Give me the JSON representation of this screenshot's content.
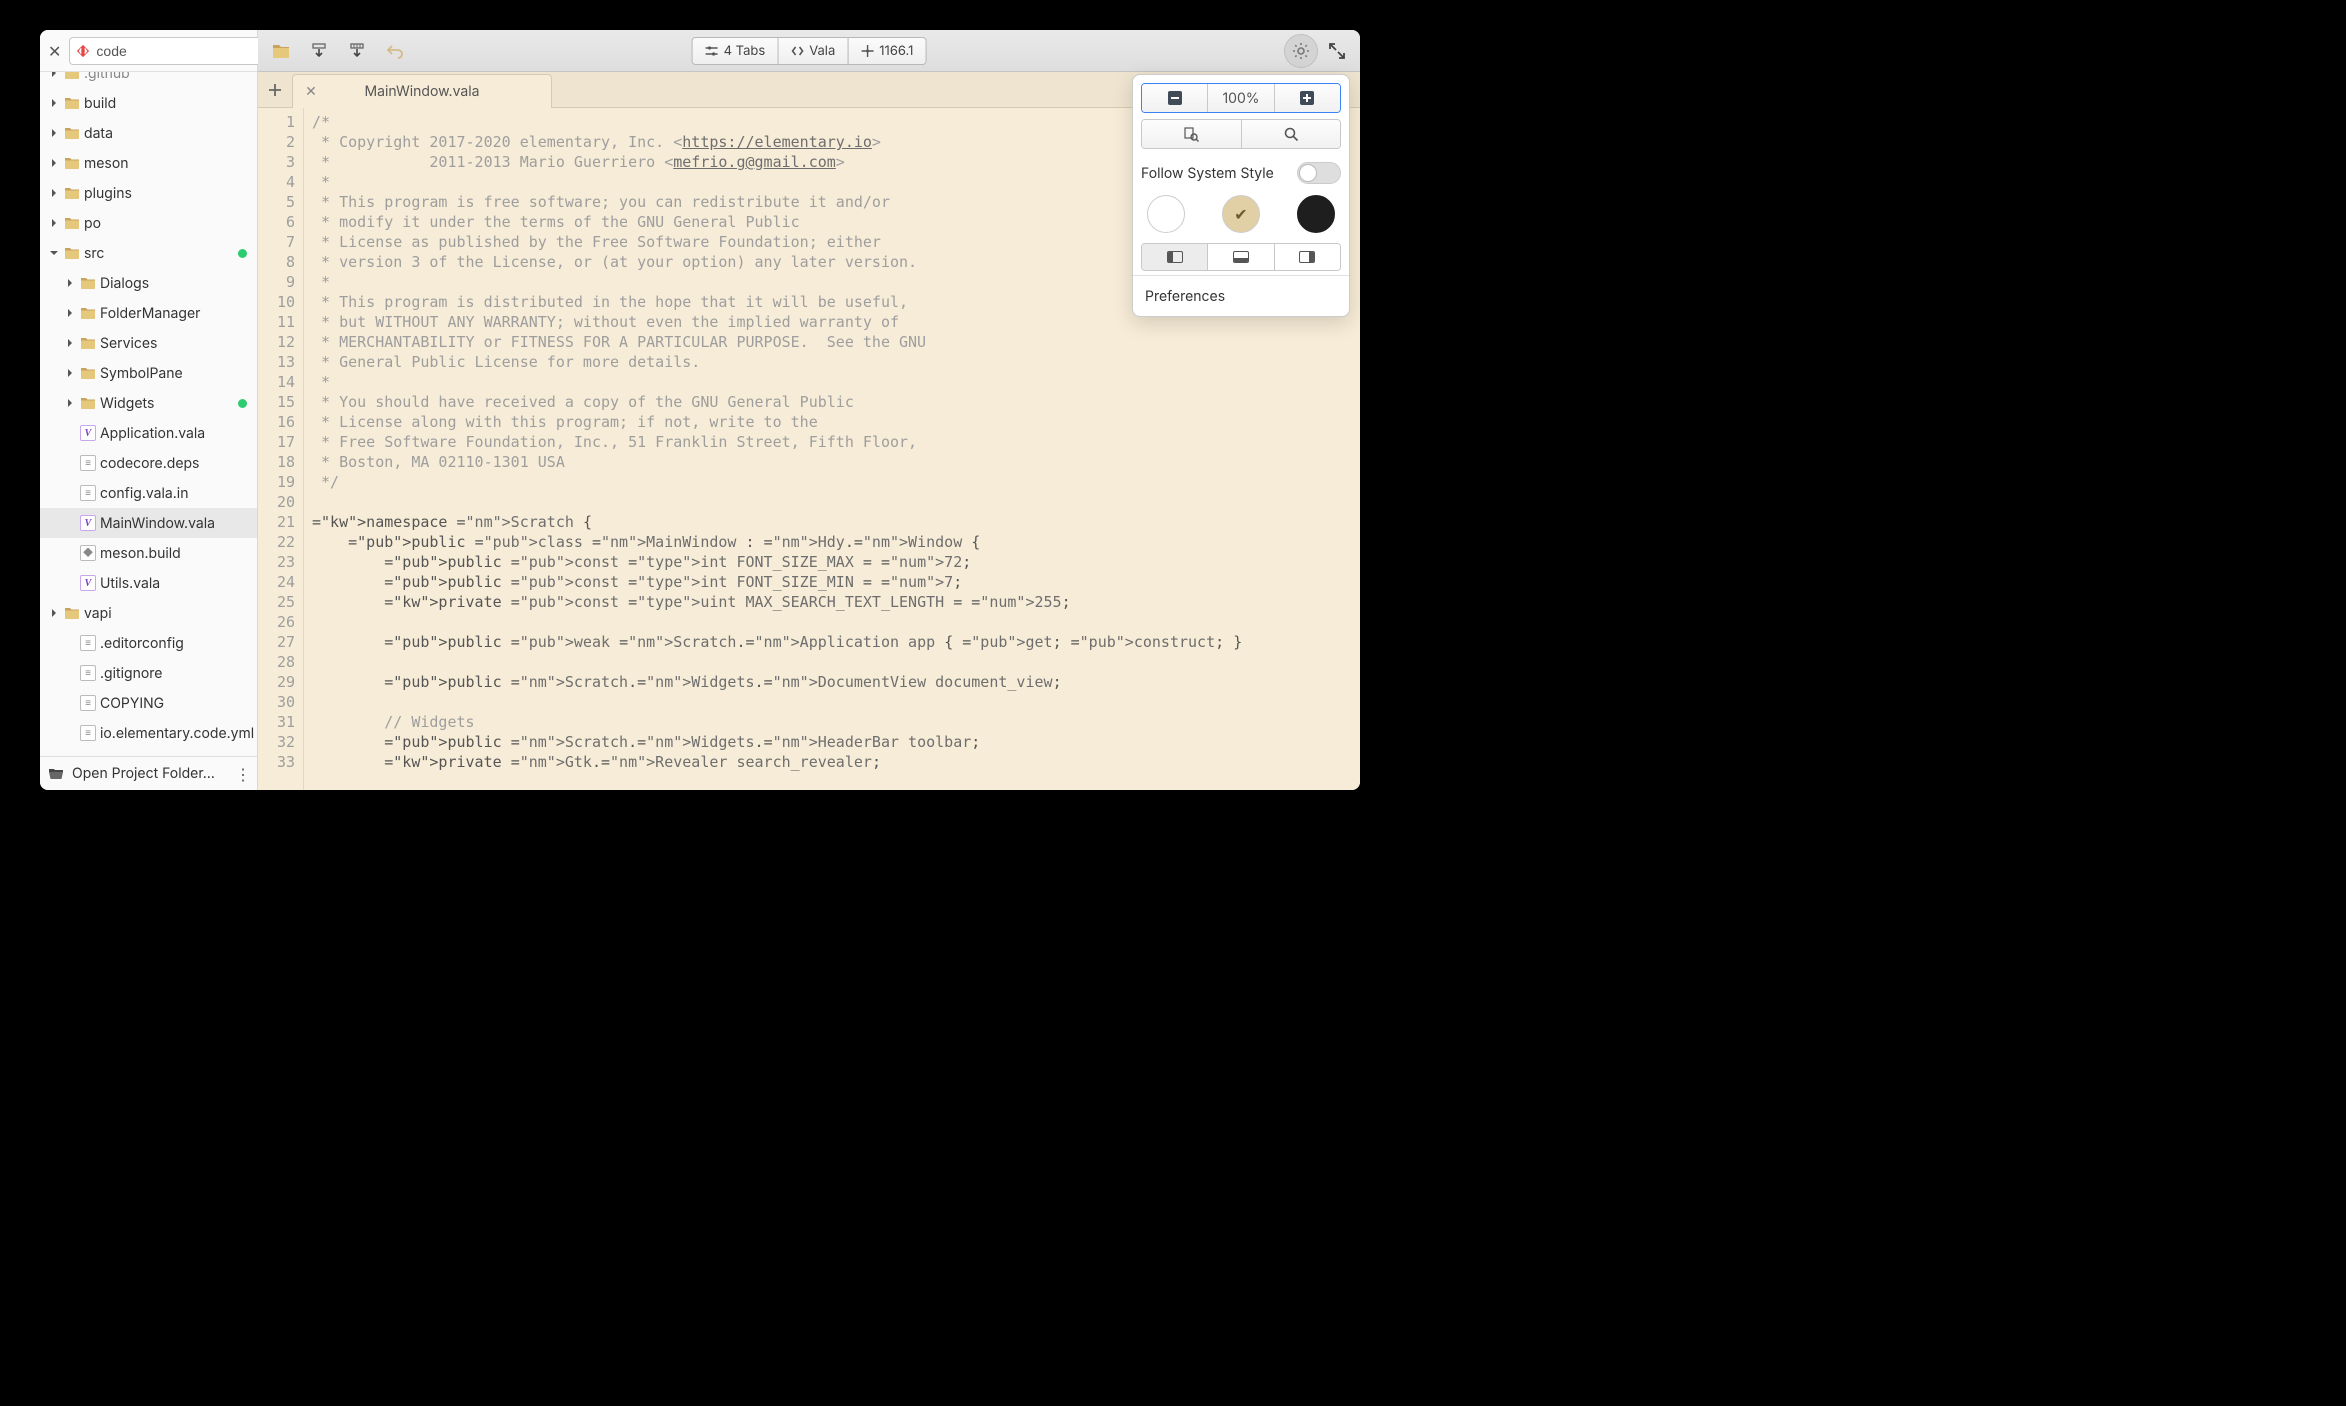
{
  "sidebar": {
    "search_value": "code",
    "items": [
      {
        "kind": "folder",
        "label": ".github",
        "depth": 0,
        "arrow": "right",
        "clipped": true
      },
      {
        "kind": "folder",
        "label": "build",
        "depth": 0,
        "arrow": "right"
      },
      {
        "kind": "folder",
        "label": "data",
        "depth": 0,
        "arrow": "right"
      },
      {
        "kind": "folder",
        "label": "meson",
        "depth": 0,
        "arrow": "right"
      },
      {
        "kind": "folder",
        "label": "plugins",
        "depth": 0,
        "arrow": "right"
      },
      {
        "kind": "folder",
        "label": "po",
        "depth": 0,
        "arrow": "right"
      },
      {
        "kind": "folder",
        "label": "src",
        "depth": 0,
        "arrow": "down",
        "dot": true
      },
      {
        "kind": "folder",
        "label": "Dialogs",
        "depth": 1,
        "arrow": "right"
      },
      {
        "kind": "folder",
        "label": "FolderManager",
        "depth": 1,
        "arrow": "right"
      },
      {
        "kind": "folder",
        "label": "Services",
        "depth": 1,
        "arrow": "right"
      },
      {
        "kind": "folder",
        "label": "SymbolPane",
        "depth": 1,
        "arrow": "right"
      },
      {
        "kind": "folder",
        "label": "Widgets",
        "depth": 1,
        "arrow": "right",
        "dot": true
      },
      {
        "kind": "file",
        "ftype": "vala",
        "label": "Application.vala",
        "depth": 1
      },
      {
        "kind": "file",
        "ftype": "text",
        "label": "codecore.deps",
        "depth": 1
      },
      {
        "kind": "file",
        "ftype": "text",
        "label": "config.vala.in",
        "depth": 1
      },
      {
        "kind": "file",
        "ftype": "vala",
        "label": "MainWindow.vala",
        "depth": 1,
        "selected": true
      },
      {
        "kind": "file",
        "ftype": "meson",
        "label": "meson.build",
        "depth": 1
      },
      {
        "kind": "file",
        "ftype": "vala",
        "label": "Utils.vala",
        "depth": 1
      },
      {
        "kind": "folder",
        "label": "vapi",
        "depth": 0,
        "arrow": "right"
      },
      {
        "kind": "file",
        "ftype": "text",
        "label": ".editorconfig",
        "depth": 1
      },
      {
        "kind": "file",
        "ftype": "text",
        "label": ".gitignore",
        "depth": 1
      },
      {
        "kind": "file",
        "ftype": "text",
        "label": "COPYING",
        "depth": 1
      },
      {
        "kind": "file",
        "ftype": "yml",
        "label": "io.elementary.code.yml",
        "depth": 1
      }
    ],
    "footer_label": "Open Project Folder…"
  },
  "header": {
    "tabs_label": "4 Tabs",
    "lang_label": "Vala",
    "pos_label": "1166.1"
  },
  "tabs": {
    "active_title": "MainWindow.vala"
  },
  "editor": {
    "lines": [
      "/*",
      " * Copyright 2017-2020 elementary, Inc. <https://elementary.io>",
      " *           2011-2013 Mario Guerriero <mefrio.g@gmail.com>",
      " *",
      " * This program is free software; you can redistribute it and/or",
      " * modify it under the terms of the GNU General Public",
      " * License as published by the Free Software Foundation; either",
      " * version 3 of the License, or (at your option) any later version.",
      " *",
      " * This program is distributed in the hope that it will be useful,",
      " * but WITHOUT ANY WARRANTY; without even the implied warranty of",
      " * MERCHANTABILITY or FITNESS FOR A PARTICULAR PURPOSE.  See the GNU",
      " * General Public License for more details.",
      " *",
      " * You should have received a copy of the GNU General Public",
      " * License along with this program; if not, write to the",
      " * Free Software Foundation, Inc., 51 Franklin Street, Fifth Floor,",
      " * Boston, MA 02110-1301 USA",
      " */",
      "",
      "namespace Scratch {",
      "    public class MainWindow : Hdy.Window {",
      "        public const int FONT_SIZE_MAX = 72;",
      "        public const int FONT_SIZE_MIN = 7;",
      "        private const uint MAX_SEARCH_TEXT_LENGTH = 255;",
      "",
      "        public weak Scratch.Application app { get; construct; }",
      "",
      "        public Scratch.Widgets.DocumentView document_view;",
      "",
      "        // Widgets",
      "        public Scratch.Widgets.HeaderBar toolbar;",
      "        private Gtk.Revealer search_revealer;"
    ]
  },
  "popover": {
    "zoom_label": "100%",
    "follow_label": "Follow System Style",
    "preferences_label": "Preferences"
  }
}
